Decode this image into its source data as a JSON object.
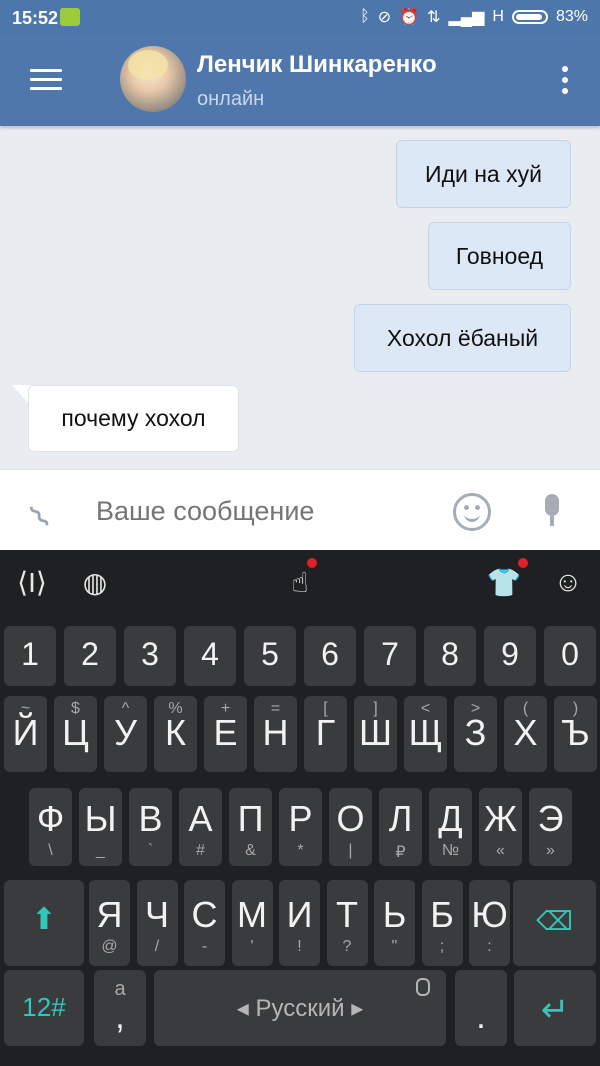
{
  "status_bar": {
    "time": "15:52",
    "network": "H",
    "battery": "83%"
  },
  "header": {
    "contact_name": "Ленчик Шинкаренко",
    "contact_status": "онлайн"
  },
  "messages": [
    {
      "text": "Иди на хуй",
      "direction": "outgoing"
    },
    {
      "text": "Говноед",
      "direction": "outgoing"
    },
    {
      "text": "Хохол ёбаный",
      "direction": "outgoing"
    },
    {
      "text": "почему хохол",
      "direction": "incoming"
    }
  ],
  "composer": {
    "placeholder": "Ваше сообщение",
    "value": ""
  },
  "keyboard": {
    "number_row": [
      "1",
      "2",
      "3",
      "4",
      "5",
      "6",
      "7",
      "8",
      "9",
      "0"
    ],
    "row1": [
      {
        "main": "Й",
        "sec": "~"
      },
      {
        "main": "Ц",
        "sec": "$"
      },
      {
        "main": "У",
        "sec": "^"
      },
      {
        "main": "К",
        "sec": "%"
      },
      {
        "main": "Е",
        "sec": "+"
      },
      {
        "main": "Н",
        "sec": "="
      },
      {
        "main": "Г",
        "sec": "["
      },
      {
        "main": "Ш",
        "sec": "]"
      },
      {
        "main": "Щ",
        "sec": "<"
      },
      {
        "main": "З",
        "sec": ">"
      },
      {
        "main": "Х",
        "sec": "("
      },
      {
        "main": "Ъ",
        "sec": ")"
      }
    ],
    "row2": [
      {
        "main": "Ф",
        "sec": "\\"
      },
      {
        "main": "Ы",
        "sec": "_"
      },
      {
        "main": "В",
        "sec": "`"
      },
      {
        "main": "А",
        "sec": "#"
      },
      {
        "main": "П",
        "sec": "&"
      },
      {
        "main": "Р",
        "sec": "*"
      },
      {
        "main": "О",
        "sec": "|"
      },
      {
        "main": "Л",
        "sec": "₽"
      },
      {
        "main": "Д",
        "sec": "№"
      },
      {
        "main": "Ж",
        "sec": "«"
      },
      {
        "main": "Э",
        "sec": "»"
      }
    ],
    "row3": [
      {
        "main": "Я",
        "sec": "@"
      },
      {
        "main": "Ч",
        "sec": "/"
      },
      {
        "main": "С",
        "sec": "-"
      },
      {
        "main": "М",
        "sec": "'"
      },
      {
        "main": "И",
        "sec": "!"
      },
      {
        "main": "Т",
        "sec": "?"
      },
      {
        "main": "Ь",
        "sec": "\""
      },
      {
        "main": "Б",
        "sec": ";"
      },
      {
        "main": "Ю",
        "sec": ":"
      }
    ],
    "symbols_key": "12#",
    "comma_key": {
      "main": ",",
      "sec": "a"
    },
    "space_label": "Русский",
    "period_key": ".",
    "accent_color": "#30c8bb"
  }
}
